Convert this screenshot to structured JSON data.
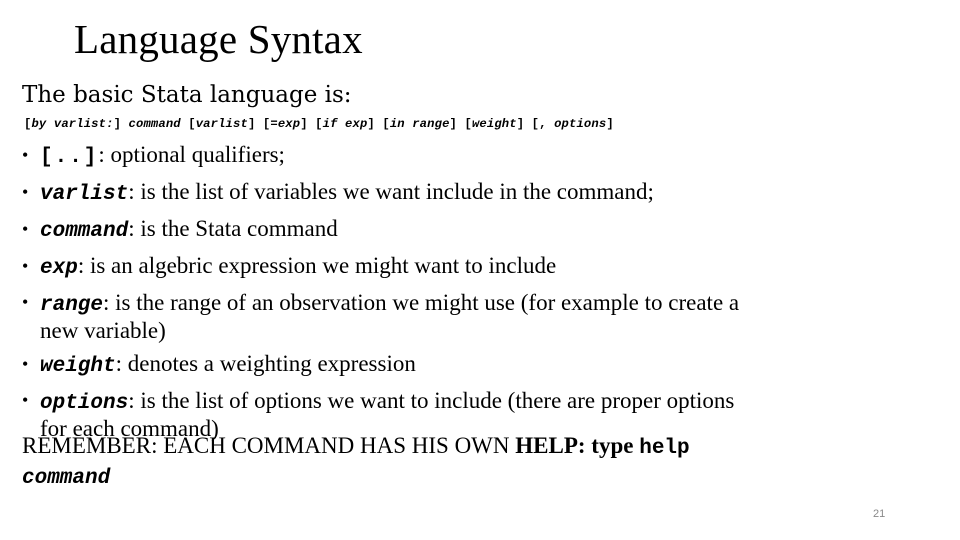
{
  "slide": {
    "title": "Language Syntax",
    "intro": "The basic Stata language is:",
    "syntax_line": {
      "parts": [
        {
          "text": "[",
          "italic": false
        },
        {
          "text": "by varlist:",
          "italic": true
        },
        {
          "text": "] ",
          "italic": false
        },
        {
          "text": "command",
          "italic": true
        },
        {
          "text": " [",
          "italic": false
        },
        {
          "text": "varlist",
          "italic": true
        },
        {
          "text": "] [=",
          "italic": false
        },
        {
          "text": "exp",
          "italic": true
        },
        {
          "text": "] [",
          "italic": false
        },
        {
          "text": "if exp",
          "italic": true
        },
        {
          "text": "] [",
          "italic": false
        },
        {
          "text": "in range",
          "italic": true
        },
        {
          "text": "] [",
          "italic": false
        },
        {
          "text": "weight",
          "italic": true
        },
        {
          "text": "] [, ",
          "italic": false
        },
        {
          "text": "options",
          "italic": true
        },
        {
          "text": "]",
          "italic": false
        }
      ]
    },
    "bullet_symbol": "•",
    "bullets": [
      {
        "term": "[..]",
        "term_italic": false,
        "description": ": optional qualifiers;"
      },
      {
        "term": "varlist",
        "term_italic": true,
        "description": ": is the list of variables we want include in the command;"
      },
      {
        "term": "command",
        "term_italic": true,
        "description": ": is the Stata command"
      },
      {
        "term": "exp",
        "term_italic": true,
        "description": ": is an algebric expression we might want to include"
      },
      {
        "term": "range",
        "term_italic": true,
        "description": ": is the range of an observation we might use (for example to create a new variable)"
      },
      {
        "term": "weight",
        "term_italic": true,
        "description": ": denotes a weighting expression"
      },
      {
        "term": "options",
        "term_italic": true,
        "description": ": is the list of options we want to include (there are proper options for each command)"
      }
    ],
    "remember": {
      "lead": "REMEMBER: EACH COMMAND HAS HIS OWN ",
      "bold": "HELP: type ",
      "mono": "help",
      "mono_italic": "command"
    },
    "page_number": "21"
  }
}
